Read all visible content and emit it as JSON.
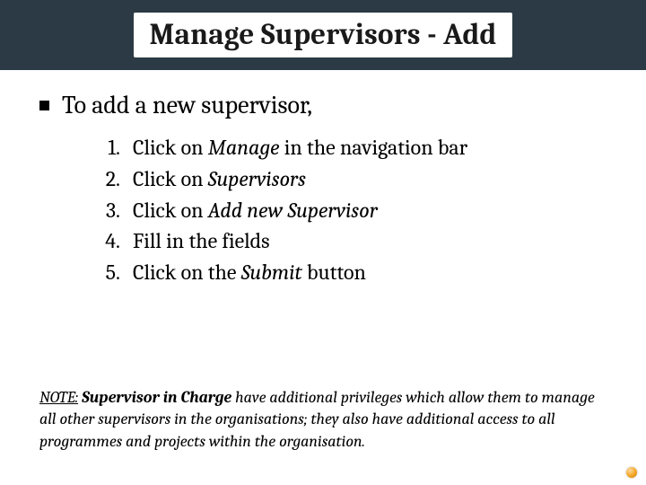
{
  "title": "Manage Supervisors - Add",
  "lead": "To add a new supervisor,",
  "steps": [
    {
      "num": "1.",
      "pre": "Click on ",
      "em": "Manage",
      "post": " in the navigation bar"
    },
    {
      "num": "2.",
      "pre": "Click on ",
      "em": "Supervisors",
      "post": ""
    },
    {
      "num": "3.",
      "pre": "Click on ",
      "em": "Add new Supervisor",
      "post": ""
    },
    {
      "num": "4.",
      "pre": "Fill in the fields",
      "em": "",
      "post": ""
    },
    {
      "num": "5.",
      "pre": "Click on the ",
      "em": "Submit",
      "post": " button"
    }
  ],
  "note": {
    "label": "NOTE:",
    "strong": "Supervisor in Charge",
    "rest": " have additional privileges which allow them to manage all other supervisors in the organisations; they also have additional access to all programmes and projects within the organisation."
  }
}
